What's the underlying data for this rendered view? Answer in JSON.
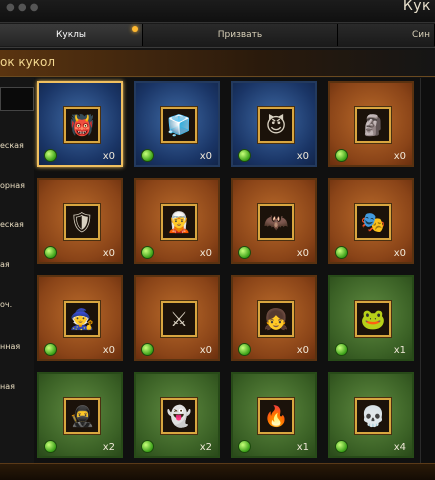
{
  "window": {
    "title": "Кук"
  },
  "tabs": [
    {
      "label": "Куклы",
      "active": true
    },
    {
      "label": "Призвать",
      "active": false
    },
    {
      "label": "Син",
      "active": false
    }
  ],
  "section": {
    "title": "ок кукол"
  },
  "sidebar": {
    "items": [
      {
        "label": "еская"
      },
      {
        "label": "орная"
      },
      {
        "label": "еская"
      },
      {
        "label": "ая"
      },
      {
        "label": "оч."
      },
      {
        "label": "нная"
      },
      {
        "label": "ная"
      }
    ]
  },
  "dolls": [
    {
      "rarity": "blue",
      "icon": "fire-demon-portrait",
      "count": "x0",
      "selected": true
    },
    {
      "rarity": "blue",
      "icon": "ice-spirit-portrait",
      "count": "x0"
    },
    {
      "rarity": "blue",
      "icon": "horned-demon-portrait",
      "count": "x0"
    },
    {
      "rarity": "orange",
      "icon": "frost-golem-portrait",
      "count": "x0"
    },
    {
      "rarity": "orange",
      "icon": "armored-knight-portrait",
      "count": "x0"
    },
    {
      "rarity": "orange",
      "icon": "white-hair-elf-portrait",
      "count": "x0"
    },
    {
      "rarity": "orange",
      "icon": "winged-beast-portrait",
      "count": "x0"
    },
    {
      "rarity": "orange",
      "icon": "masked-warrior-portrait",
      "count": "x0"
    },
    {
      "rarity": "orange",
      "icon": "dark-mage-portrait",
      "count": "x0"
    },
    {
      "rarity": "orange",
      "icon": "golden-warrior-portrait",
      "count": "x0"
    },
    {
      "rarity": "orange",
      "icon": "blue-hair-girl-portrait",
      "count": "x0"
    },
    {
      "rarity": "green",
      "icon": "frog-portrait",
      "count": "x1"
    },
    {
      "rarity": "green",
      "icon": "blue-warrior-portrait",
      "count": "x2"
    },
    {
      "rarity": "green",
      "icon": "pale-ghoul-portrait",
      "count": "x2"
    },
    {
      "rarity": "green",
      "icon": "red-knight-portrait",
      "count": "x1"
    },
    {
      "rarity": "green",
      "icon": "skeleton-portrait",
      "count": "x4"
    }
  ]
}
